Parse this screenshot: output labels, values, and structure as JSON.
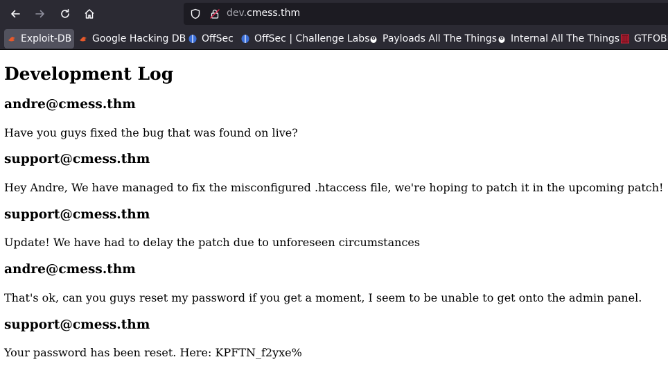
{
  "browser": {
    "url_prefix": "dev.",
    "url_domain": "cmess.thm",
    "bookmarks": [
      {
        "label": "Exploit-DB",
        "icon": "exploit-db-icon",
        "color": "#e8592b"
      },
      {
        "label": "Google Hacking DB",
        "icon": "ghdb-icon",
        "color": "#e8592b"
      },
      {
        "label": "OffSec",
        "icon": "offsec-icon",
        "color": "#3c6fd8"
      },
      {
        "label": "OffSec | Challenge Labs",
        "icon": "offsec-icon",
        "color": "#3c6fd8"
      },
      {
        "label": "Payloads All The Things",
        "icon": "payloads-icon",
        "color": "#ffffff"
      },
      {
        "label": "Internal All The Things",
        "icon": "internal-icon",
        "color": "#ffffff"
      },
      {
        "label": "GTFOBins",
        "icon": "gtfobins-icon",
        "color": "#d7263d"
      }
    ]
  },
  "page": {
    "title": "Development Log",
    "entries": [
      {
        "author": "andre@cmess.thm",
        "message": "Have you guys fixed the bug that was found on live?"
      },
      {
        "author": "support@cmess.thm",
        "message": "Hey Andre, We have managed to fix the misconfigured .htaccess file, we're hoping to patch it in the upcoming patch!"
      },
      {
        "author": "support@cmess.thm",
        "message": "Update! We have had to delay the patch due to unforeseen circumstances"
      },
      {
        "author": "andre@cmess.thm",
        "message": "That's ok, can you guys reset my password if you get a moment, I seem to be unable to get onto the admin panel."
      },
      {
        "author": "support@cmess.thm",
        "message": "Your password has been reset. Here: KPFTN_f2yxe%"
      }
    ]
  }
}
